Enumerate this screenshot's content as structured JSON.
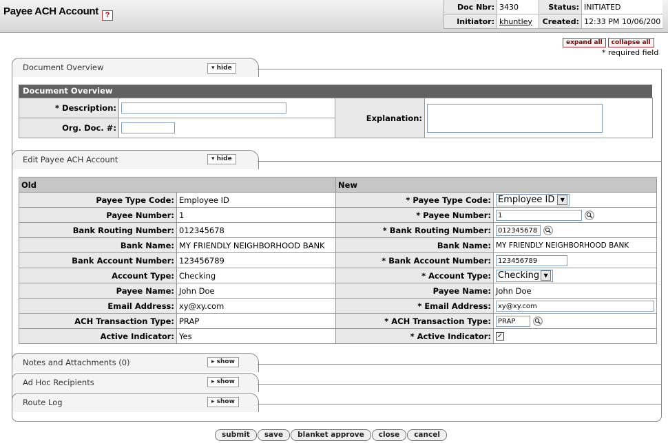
{
  "header": {
    "title": "Payee ACH Account",
    "help_icon": "?",
    "doc_nbr_label": "Doc Nbr:",
    "doc_nbr": "3430",
    "status_label": "Status:",
    "status": "INITIATED",
    "initiator_label": "Initiator:",
    "initiator": "khuntley",
    "created_label": "Created:",
    "created": "12:33 PM 10/06/200"
  },
  "top_buttons": {
    "expand_all": "expand all",
    "collapse_all": "collapse all"
  },
  "required_note": "* required field",
  "tabs": {
    "document_overview": {
      "title": "Document Overview",
      "toggle": "▾ hide"
    },
    "edit_payee": {
      "title": "Edit Payee ACH Account",
      "toggle": "▾ hide"
    },
    "notes": {
      "title": "Notes and Attachments (0)",
      "toggle": "▸ show"
    },
    "adhoc": {
      "title": "Ad Hoc Recipients",
      "toggle": "▸ show"
    },
    "route_log": {
      "title": "Route Log",
      "toggle": "▸ show"
    }
  },
  "document_overview": {
    "header": "Document Overview",
    "description_label": "* Description:",
    "description_value": "",
    "org_doc_label": "Org. Doc. #:",
    "org_doc_value": "",
    "explanation_label": "Explanation:",
    "explanation_value": ""
  },
  "edit_section": {
    "old_header": "Old",
    "new_header": "New",
    "rows": [
      {
        "old_label": "Payee Type Code:",
        "old_value": "Employee ID",
        "new_label": "*  Payee Type Code:",
        "new_value": "Employee ID"
      },
      {
        "old_label": "Payee Number:",
        "old_value": "1",
        "new_label": "*  Payee Number:",
        "new_value": "1"
      },
      {
        "old_label": "Bank Routing Number:",
        "old_value": "012345678",
        "new_label": "*  Bank Routing Number:",
        "new_value": "012345678"
      },
      {
        "old_label": "Bank Name:",
        "old_value": "MY FRIENDLY NEIGHBORHOOD BANK",
        "new_label": "Bank Name:",
        "new_value": "MY FRIENDLY NEIGHBORHOOD BANK"
      },
      {
        "old_label": "Bank Account Number:",
        "old_value": "123456789",
        "new_label": "*  Bank Account Number:",
        "new_value": "123456789"
      },
      {
        "old_label": "Account Type:",
        "old_value": "Checking",
        "new_label": "*  Account Type:",
        "new_value": "Checking"
      },
      {
        "old_label": "Payee Name:",
        "old_value": "John Doe",
        "new_label": "Payee Name:",
        "new_value": "John Doe"
      },
      {
        "old_label": "Email Address:",
        "old_value": "xy@xy.com",
        "new_label": "*  Email Address:",
        "new_value": "xy@xy.com"
      },
      {
        "old_label": "ACH Transaction Type:",
        "old_value": "PRAP",
        "new_label": "*  ACH Transaction Type:",
        "new_value": "PRAP"
      },
      {
        "old_label": "Active Indicator:",
        "old_value": "Yes",
        "new_label": "*  Active Indicator:",
        "new_value": "✓"
      }
    ]
  },
  "bottom_buttons": {
    "submit": "submit",
    "save": "save",
    "blanket_approve": "blanket approve",
    "close": "close",
    "cancel": "cancel"
  },
  "icons": {
    "lookup": "magnifier-icon",
    "help": "help-icon",
    "dropdown": "chevron-down-icon"
  }
}
